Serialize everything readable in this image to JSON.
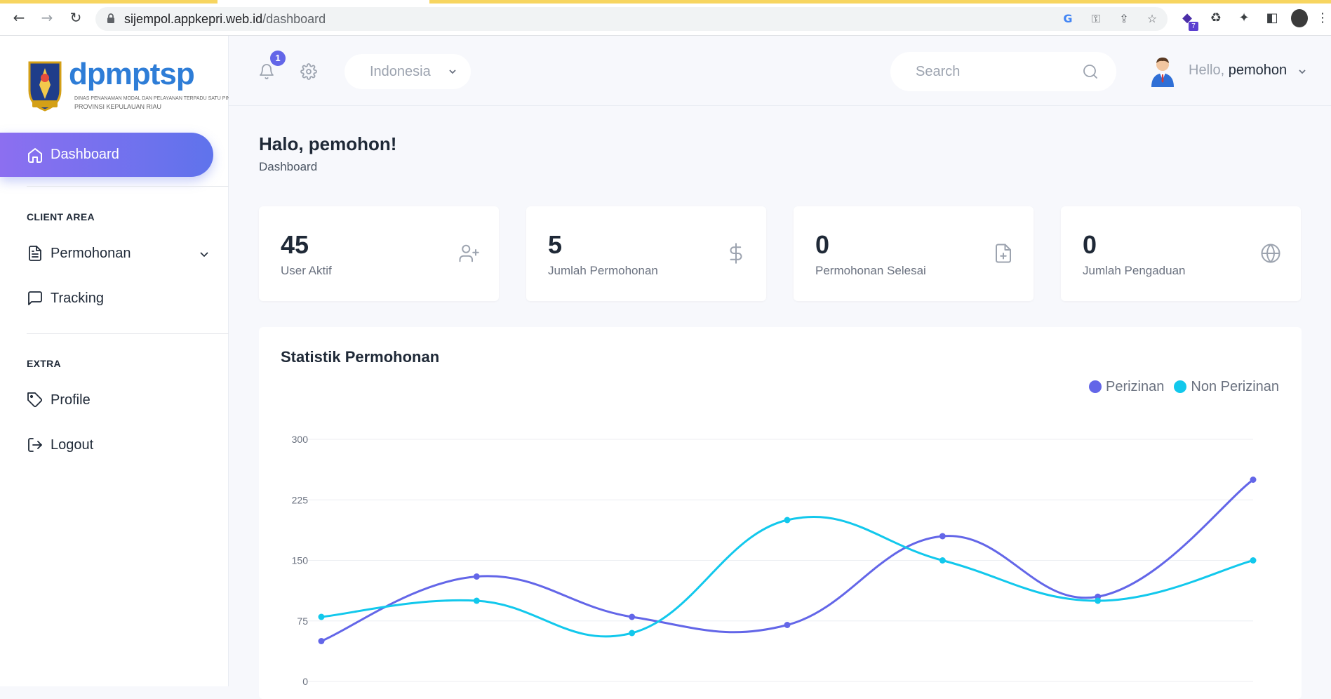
{
  "browser": {
    "url_host": "sijempol.appkepri.web.id",
    "url_path": "/dashboard",
    "extension_badge": "7"
  },
  "sidebar": {
    "logo_text": "dpmptsp",
    "logo_sub1": "DINAS PENANAMAN MODAL DAN PELAYANAN TERPADU SATU PINTU",
    "logo_sub2": "PROVINSI KEPULAUAN RIAU",
    "active_item": "Dashboard",
    "sections": [
      {
        "title": "CLIENT AREA",
        "items": [
          {
            "label": "Permohonan",
            "icon": "file-text-icon",
            "has_submenu": true
          },
          {
            "label": "Tracking",
            "icon": "message-square-icon"
          }
        ]
      },
      {
        "title": "EXTRA",
        "items": [
          {
            "label": "Profile",
            "icon": "tag-icon"
          },
          {
            "label": "Logout",
            "icon": "log-out-icon"
          }
        ]
      }
    ]
  },
  "header": {
    "notification_count": "1",
    "country": "Indonesia",
    "search_placeholder": "Search",
    "hello_prefix": "Hello, ",
    "username": "pemohon"
  },
  "main": {
    "title": "Halo, pemohon!",
    "breadcrumb": "Dashboard",
    "stats": [
      {
        "value": "45",
        "label": "User Aktif",
        "icon": "user-plus-icon"
      },
      {
        "value": "5",
        "label": "Jumlah Permohonan",
        "icon": "dollar-sign-icon"
      },
      {
        "value": "0",
        "label": "Permohonan Selesai",
        "icon": "file-plus-icon"
      },
      {
        "value": "0",
        "label": "Jumlah Pengaduan",
        "icon": "globe-icon"
      }
    ]
  },
  "colors": {
    "accent": "#6366e8",
    "perizinan": "#6366e8",
    "non_perizinan": "#12c8ec"
  },
  "chart_data": {
    "type": "line",
    "title": "Statistik Permohonan",
    "x": [
      0,
      1,
      2,
      3,
      4,
      5,
      6
    ],
    "ylim": [
      0,
      300
    ],
    "yticks": [
      0,
      75,
      150,
      225,
      300
    ],
    "grid": true,
    "legend": "top-right",
    "series": [
      {
        "name": "Perizinan",
        "color": "#6366e8",
        "values": [
          50,
          130,
          80,
          70,
          180,
          105,
          250
        ]
      },
      {
        "name": "Non Perizinan",
        "color": "#12c8ec",
        "values": [
          80,
          100,
          60,
          200,
          150,
          100,
          150
        ]
      }
    ]
  }
}
